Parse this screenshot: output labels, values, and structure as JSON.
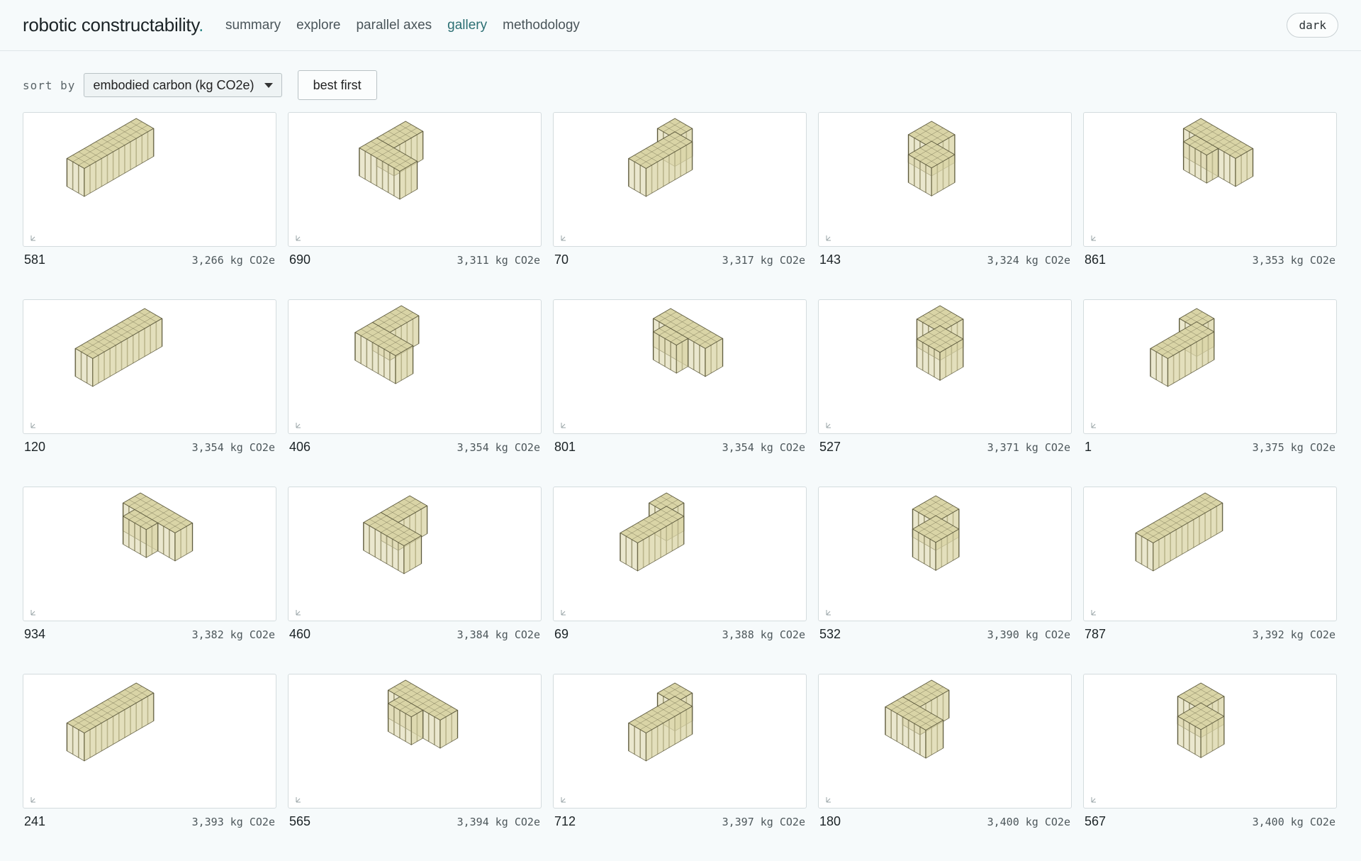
{
  "app": {
    "title": "robotic constructability",
    "title_dot": "."
  },
  "nav": [
    {
      "label": "summary",
      "active": false
    },
    {
      "label": "explore",
      "active": false
    },
    {
      "label": "parallel axes",
      "active": false
    },
    {
      "label": "gallery",
      "active": true
    },
    {
      "label": "methodology",
      "active": false
    }
  ],
  "theme_toggle": {
    "label": "dark"
  },
  "controls": {
    "sort_label": "sort by",
    "sort_value": "embodied carbon (kg CO2e)",
    "order_label": "best first"
  },
  "colors": {
    "accent": "#2c6f73",
    "model_fill": "#d9d4a6",
    "model_stroke": "#5d5a3e"
  },
  "cards": [
    {
      "id": "581",
      "carbon": "3,266 kg CO2e",
      "shape": "long"
    },
    {
      "id": "690",
      "carbon": "3,311 kg CO2e",
      "shape": "t"
    },
    {
      "id": "70",
      "carbon": "3,317 kg CO2e",
      "shape": "l"
    },
    {
      "id": "143",
      "carbon": "3,324 kg CO2e",
      "shape": "z"
    },
    {
      "id": "861",
      "carbon": "3,353 kg CO2e",
      "shape": "wide"
    },
    {
      "id": "120",
      "carbon": "3,354 kg CO2e",
      "shape": "long"
    },
    {
      "id": "406",
      "carbon": "3,354 kg CO2e",
      "shape": "t"
    },
    {
      "id": "801",
      "carbon": "3,354 kg CO2e",
      "shape": "wide"
    },
    {
      "id": "527",
      "carbon": "3,371 kg CO2e",
      "shape": "z"
    },
    {
      "id": "1",
      "carbon": "3,375 kg CO2e",
      "shape": "l"
    },
    {
      "id": "934",
      "carbon": "3,382 kg CO2e",
      "shape": "wide"
    },
    {
      "id": "460",
      "carbon": "3,384 kg CO2e",
      "shape": "t"
    },
    {
      "id": "69",
      "carbon": "3,388 kg CO2e",
      "shape": "l"
    },
    {
      "id": "532",
      "carbon": "3,390 kg CO2e",
      "shape": "z"
    },
    {
      "id": "787",
      "carbon": "3,392 kg CO2e",
      "shape": "long"
    },
    {
      "id": "241",
      "carbon": "3,393 kg CO2e",
      "shape": "long"
    },
    {
      "id": "565",
      "carbon": "3,394 kg CO2e",
      "shape": "wide"
    },
    {
      "id": "712",
      "carbon": "3,397 kg CO2e",
      "shape": "l"
    },
    {
      "id": "180",
      "carbon": "3,400 kg CO2e",
      "shape": "t"
    },
    {
      "id": "567",
      "carbon": "3,400 kg CO2e",
      "shape": "z"
    }
  ]
}
